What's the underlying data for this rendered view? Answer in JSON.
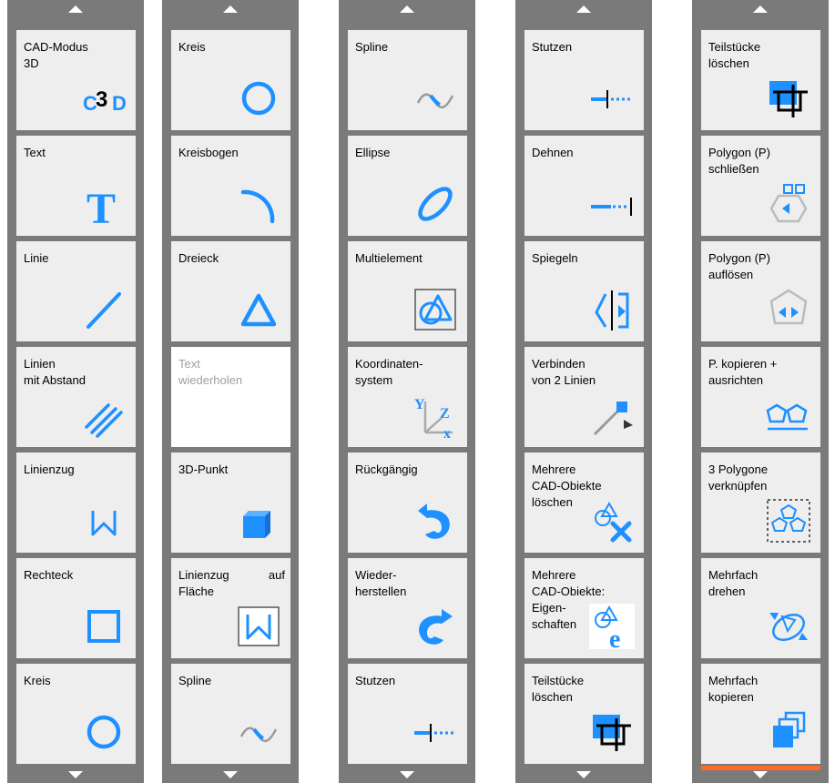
{
  "columns": [
    {
      "tiles": [
        {
          "label": "CAD-Modus\n3D",
          "icon": "cad-3d-icon"
        },
        {
          "label": "Text",
          "icon": "text-t-icon"
        },
        {
          "label": "Linie",
          "icon": "line-icon"
        },
        {
          "label": "Linien\nmit Abstand",
          "icon": "parallel-lines-icon"
        },
        {
          "label": "Linienzug",
          "icon": "polyline-icon"
        },
        {
          "label": "Rechteck",
          "icon": "rectangle-icon"
        },
        {
          "label": "Kreis",
          "icon": "circle-icon"
        }
      ]
    },
    {
      "tiles": [
        {
          "label": "Kreis",
          "icon": "circle-icon"
        },
        {
          "label": "Kreisbogen",
          "icon": "arc-icon"
        },
        {
          "label": "Dreieck",
          "icon": "triangle-icon"
        },
        {
          "label": "Text\nwiederholen",
          "icon": "",
          "disabled": true
        },
        {
          "label": "3D-Punkt",
          "icon": "cube-icon"
        },
        {
          "label": "Linienzug auf\nFläche",
          "icon": "polyline-on-surface-icon"
        },
        {
          "label": "Spline",
          "icon": "spline-icon"
        }
      ]
    },
    {
      "tiles": [
        {
          "label": "Spline",
          "icon": "spline-icon"
        },
        {
          "label": "Ellipse",
          "icon": "ellipse-icon"
        },
        {
          "label": "Multielement",
          "icon": "multielement-icon"
        },
        {
          "label": "Koordinaten-\nsystem",
          "icon": "coordinate-system-icon"
        },
        {
          "label": "Rückgängig",
          "icon": "undo-icon"
        },
        {
          "label": "Wieder-\nherstellen",
          "icon": "redo-icon"
        },
        {
          "label": "Stutzen",
          "icon": "trim-icon"
        }
      ]
    },
    {
      "tiles": [
        {
          "label": "Stutzen",
          "icon": "trim-icon"
        },
        {
          "label": "Dehnen",
          "icon": "extend-icon"
        },
        {
          "label": "Spiegeln",
          "icon": "mirror-icon"
        },
        {
          "label": "Verbinden\nvon 2 Linien",
          "icon": "connect-lines-icon"
        },
        {
          "label": "Mehrere\nCAD-Obiekte\nlöschen",
          "icon": "delete-multiple-icon"
        },
        {
          "label": "Mehrere\nCAD-Obiekte:\nEigen-\nschaften",
          "icon": "properties-multiple-icon"
        },
        {
          "label": "Teilstücke\nlöschen",
          "icon": "delete-segments-icon"
        }
      ]
    },
    {
      "tiles": [
        {
          "label": "Teilstücke\nlöschen",
          "icon": "delete-segments-icon"
        },
        {
          "label": "Polygon (P)\nschließen",
          "icon": "polygon-close-icon"
        },
        {
          "label": "Polygon (P)\nauflösen",
          "icon": "polygon-dissolve-icon"
        },
        {
          "label": "P. kopieren +\nausrichten",
          "icon": "polygon-copy-align-icon"
        },
        {
          "label": "3 Polygone\nverknüpfen",
          "icon": "polygon-link-icon"
        },
        {
          "label": "Mehrfach\ndrehen",
          "icon": "multi-rotate-icon"
        },
        {
          "label": "Mehrfach\nkopieren",
          "icon": "multi-copy-icon"
        }
      ]
    }
  ],
  "colors": {
    "accent": "#1e90ff",
    "frame": "#7a7a7a",
    "tile": "#eeeeee",
    "highlight": "#ff6a2b"
  }
}
